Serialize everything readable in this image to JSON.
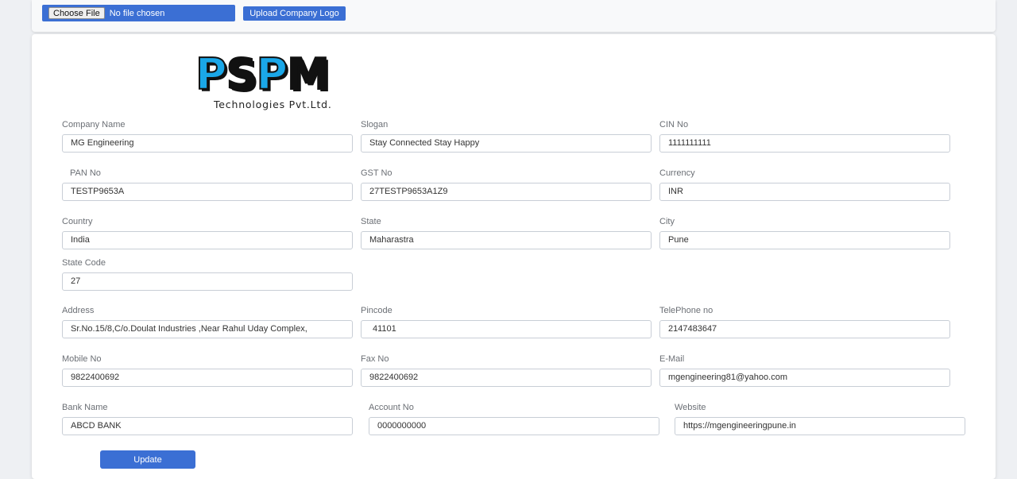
{
  "upload_bar": {
    "file_button_label": "Choose File",
    "file_status": "No file chosen",
    "upload_button_label": "Upload Company Logo"
  },
  "logo": {
    "letters": [
      "P",
      "S",
      "P",
      "M"
    ],
    "letter_colors": [
      "#1aa7e8",
      "#111111",
      "#1aa7e8",
      "#111111"
    ],
    "subtitle": "Technologies Pvt.Ltd."
  },
  "form": {
    "fields": [
      {
        "key": "company_name",
        "label": "Company Name",
        "value": "MG Engineering"
      },
      {
        "key": "slogan",
        "label": "Slogan",
        "value": "Stay Connected Stay Happy"
      },
      {
        "key": "cin_no",
        "label": "CIN No",
        "value": "1111111111"
      },
      {
        "key": "pan_no",
        "label": "PAN No",
        "value": "TESTP9653A"
      },
      {
        "key": "gst_no",
        "label": "GST No",
        "value": "27TESTP9653A1Z9"
      },
      {
        "key": "currency",
        "label": "Currency",
        "value": "INR"
      },
      {
        "key": "country",
        "label": "Country",
        "value": "India"
      },
      {
        "key": "state",
        "label": "State",
        "value": "Maharastra"
      },
      {
        "key": "city",
        "label": "City",
        "value": "Pune"
      },
      {
        "key": "state_code",
        "label": "State Code",
        "value": "27"
      },
      {
        "key": "address",
        "label": "Address",
        "value": "Sr.No.15/8,C/o.Doulat Industries ,Near Rahul Uday Complex,"
      },
      {
        "key": "pincode",
        "label": "Pincode",
        "value": "41101"
      },
      {
        "key": "telephone",
        "label": "TelePhone no",
        "value": "2147483647"
      },
      {
        "key": "mobile",
        "label": "Mobile No",
        "value": "9822400692"
      },
      {
        "key": "fax",
        "label": "Fax No",
        "value": "9822400692"
      },
      {
        "key": "email",
        "label": "E-Mail",
        "value": "mgengineering81@yahoo.com"
      },
      {
        "key": "bank_name",
        "label": "Bank Name",
        "value": "ABCD BANK"
      },
      {
        "key": "account_no",
        "label": "Account No",
        "value": "0000000000"
      },
      {
        "key": "website",
        "label": "Website",
        "value": "https://mgengineeringpune.in"
      }
    ],
    "update_button_label": "Update"
  },
  "colors": {
    "accent": "#3b6fd4",
    "logo_blue": "#1aa7e8"
  }
}
